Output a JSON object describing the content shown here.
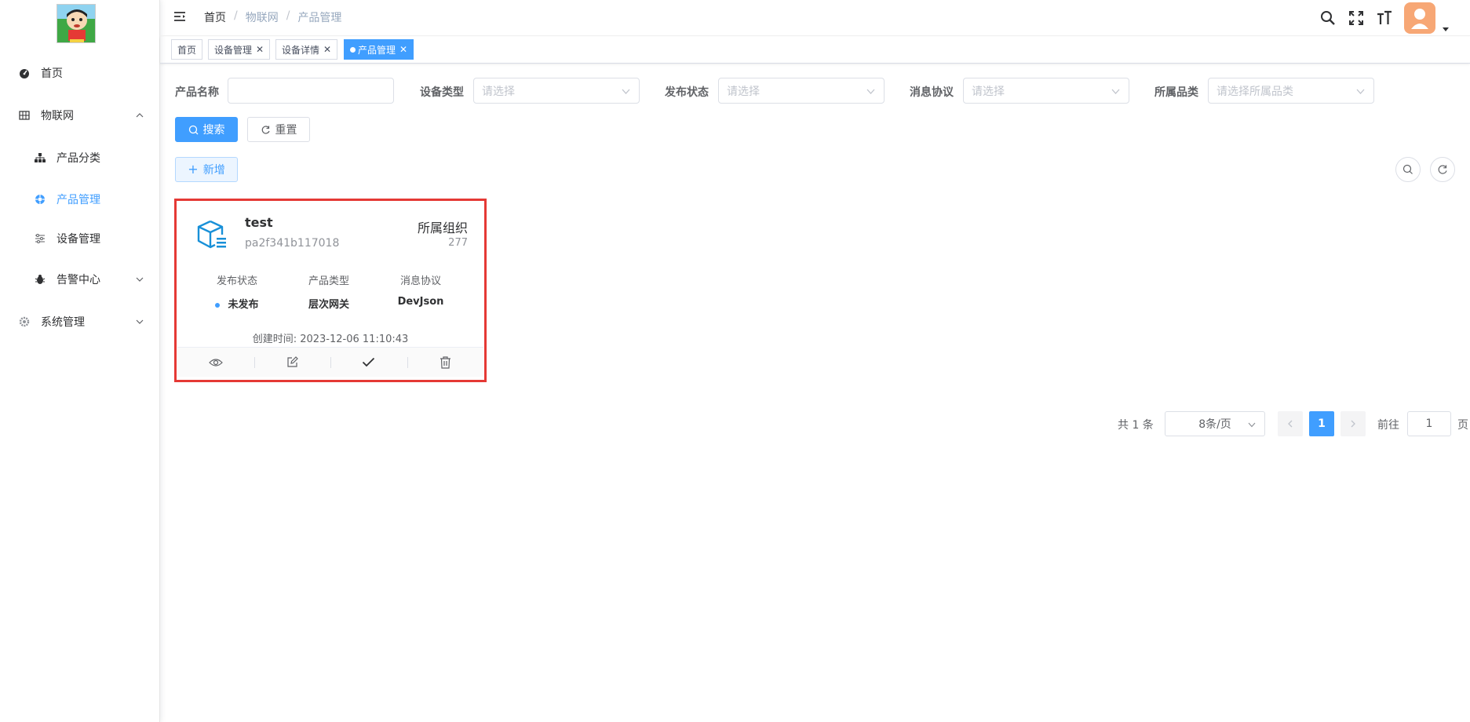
{
  "sidebar": {
    "items": [
      {
        "label": "首页",
        "icon": "dashboard-icon"
      },
      {
        "label": "物联网",
        "icon": "grid-icon"
      },
      {
        "label": "产品分类",
        "icon": "tree-icon"
      },
      {
        "label": "产品管理",
        "icon": "product-icon"
      },
      {
        "label": "设备管理",
        "icon": "sliders-icon"
      },
      {
        "label": "告警中心",
        "icon": "bug-icon"
      },
      {
        "label": "系统管理",
        "icon": "gear-icon"
      }
    ],
    "active_color": "#409eff"
  },
  "breadcrumb": [
    "首页",
    "物联网",
    "产品管理"
  ],
  "tabs": [
    {
      "label": "首页"
    },
    {
      "label": "设备管理"
    },
    {
      "label": "设备详情"
    },
    {
      "label": "产品管理"
    }
  ],
  "filters": {
    "product_name_label": "产品名称",
    "device_type_label": "设备类型",
    "device_type_placeholder": "请选择",
    "publish_status_label": "发布状态",
    "publish_status_placeholder": "请选择",
    "protocol_label": "消息协议",
    "protocol_placeholder": "请选择",
    "category_label": "所属品类",
    "category_placeholder": "请选择所属品类"
  },
  "buttons": {
    "search": "搜索",
    "reset": "重置",
    "add": "新增"
  },
  "card": {
    "title": "test",
    "code": "pa2f341b117018",
    "org_label": "所属组织",
    "org_value": "277",
    "attrs": [
      {
        "label": "发布状态",
        "value": "未发布"
      },
      {
        "label": "产品类型",
        "value": "层次网关"
      },
      {
        "label": "消息协议",
        "value": "DevJson"
      }
    ],
    "created": "创建时间: 2023-12-06 11:10:43"
  },
  "pagination": {
    "total": "共 1 条",
    "page_size": "8条/页",
    "current": "1",
    "goto_label": "前往",
    "goto_value": "1",
    "page_suffix": "页"
  },
  "colors": {
    "primary": "#409eff",
    "highlight_border": "#e53935"
  }
}
